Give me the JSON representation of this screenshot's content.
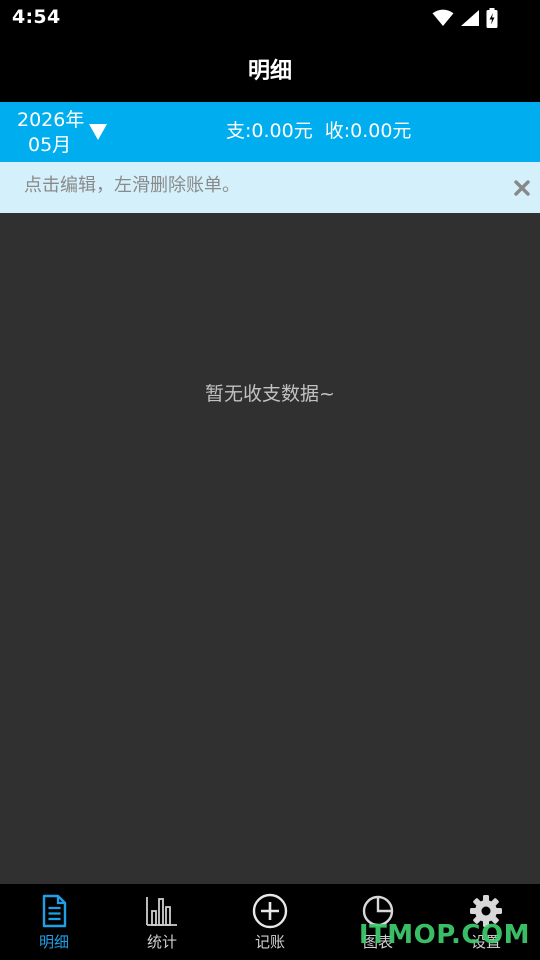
{
  "status_bar": {
    "time": "4:54"
  },
  "header": {
    "title": "明细"
  },
  "summary": {
    "year": "2026年",
    "month": "05月",
    "expense": "支:0.00元",
    "income": "收:0.00元"
  },
  "tip": {
    "text": "点击编辑，左滑删除账单。"
  },
  "content": {
    "empty_text": "暂无收支数据~"
  },
  "tabs": [
    {
      "label": "明细",
      "icon": "document-icon",
      "active": true
    },
    {
      "label": "统计",
      "icon": "bar-chart-icon",
      "active": false
    },
    {
      "label": "记账",
      "icon": "add-circle-icon",
      "active": false
    },
    {
      "label": "图表",
      "icon": "pie-chart-icon",
      "active": false
    },
    {
      "label": "设置",
      "icon": "gear-icon",
      "active": false
    }
  ],
  "watermark": "ITMOP.COM",
  "colors": {
    "accent": "#00aeef",
    "tip_background": "#d4f1fb",
    "content_background": "#303030",
    "active_tab": "#1ea0e6"
  }
}
